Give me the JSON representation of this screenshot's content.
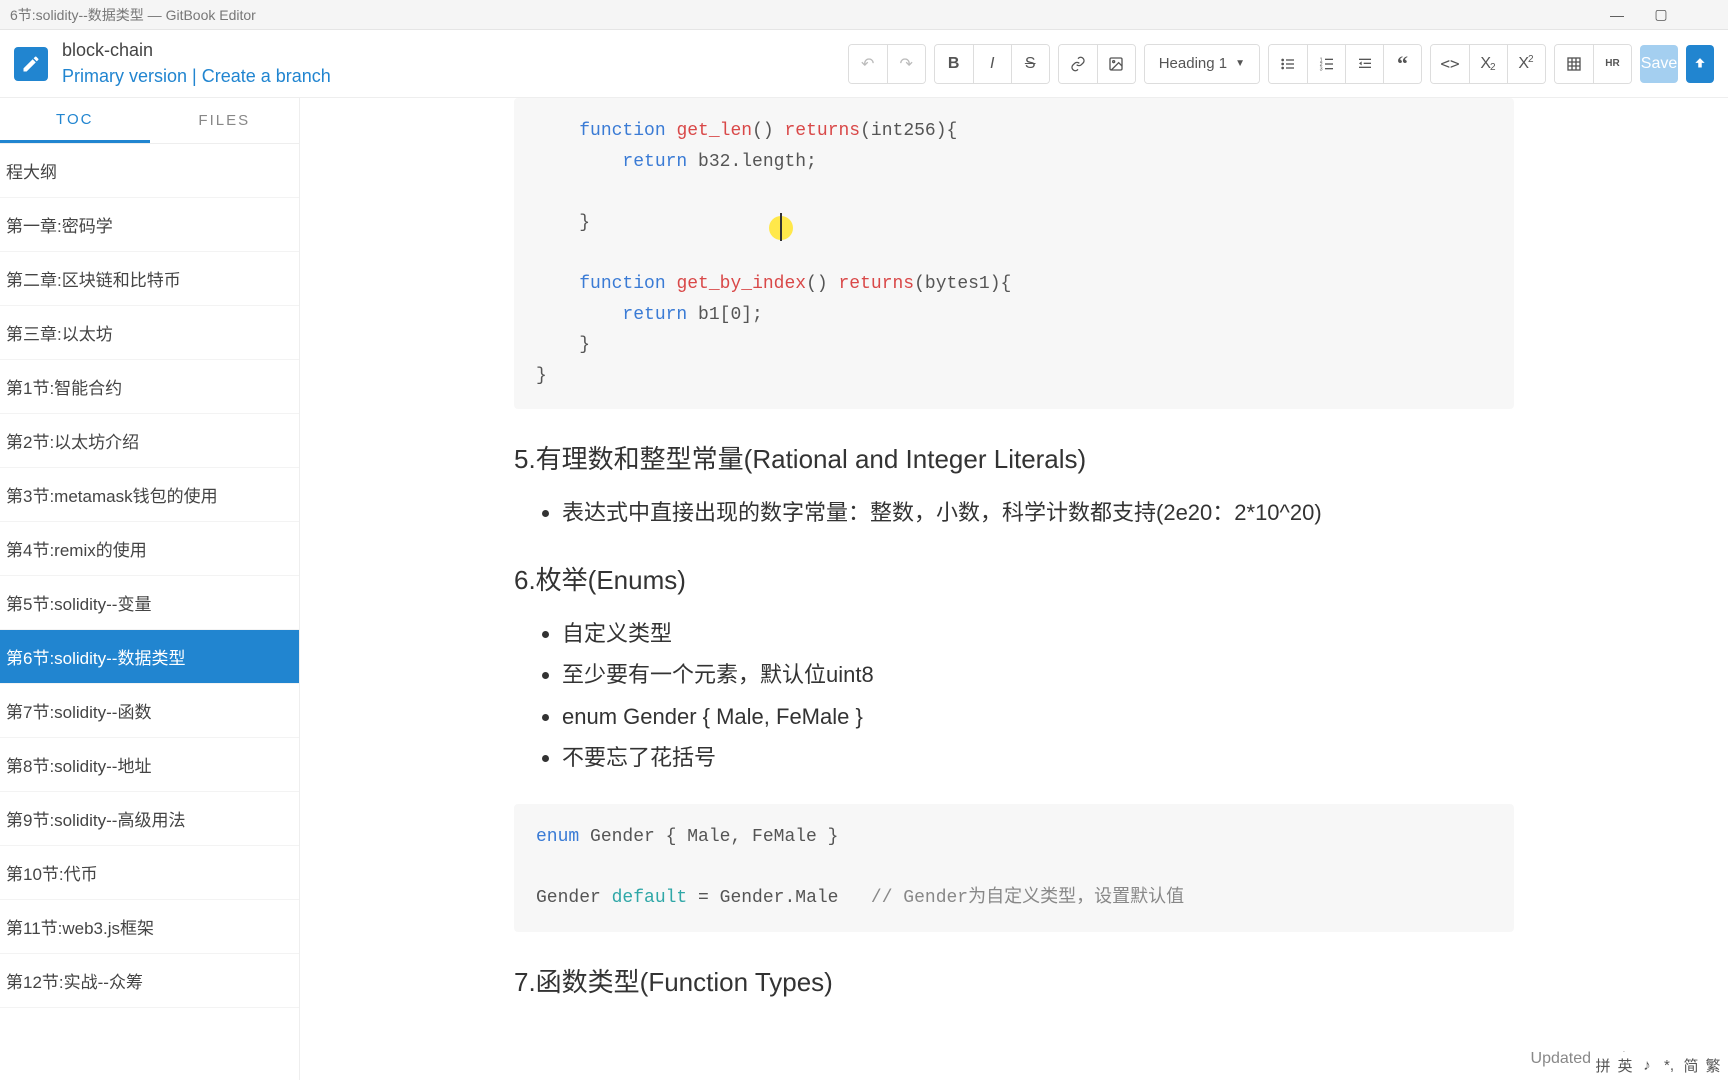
{
  "titlebar": {
    "title": "6节:solidity--数据类型 — GitBook Editor"
  },
  "header": {
    "bookname": "block-chain",
    "primary": "Primary version",
    "sep": "   |   ",
    "create_branch": "Create a branch",
    "heading_dd": "Heading 1",
    "save": "Save"
  },
  "tabs": {
    "toc": "TOC",
    "files": "FILES"
  },
  "toc": [
    "程大纲",
    "第一章:密码学",
    "第二章:区块链和比特币",
    "第三章:以太坊",
    "第1节:智能合约",
    "第2节:以太坊介绍",
    "第3节:metamask钱包的使用",
    "第4节:remix的使用",
    "第5节:solidity--变量",
    "第6节:solidity--数据类型",
    "第7节:solidity--函数",
    "第8节:solidity--地址",
    "第9节:solidity--高级用法",
    "第10节:代币",
    "第11节:web3.js框架",
    "第12节:实战--众筹"
  ],
  "toc_active_index": 9,
  "content": {
    "sec5_title": "5.有理数和整型常量(Rational and Integer Literals)",
    "sec5_item1": "表达式中直接出现的数字常量：整数，小数，科学计数都支持(2e20：2*10^20)",
    "sec6_title": "6.枚举(Enums)",
    "sec6_items": [
      "自定义类型",
      "至少要有一个元素，默认位uint8",
      "enum Gender { Male, FeMale }",
      "不要忘了花括号"
    ],
    "sec7_title": "7.函数类型(Function Types)"
  },
  "status": "Updated a minute ago",
  "ime": {
    "a": "拼",
    "b": "英",
    "c": "♪",
    "d": "*,",
    "e": "简",
    "f": "繁"
  },
  "code1": {
    "l1_kw1": "function",
    "l1_fn": "get_len",
    "l1_p": "() ",
    "l1_kw2": "returns",
    "l1_rest": "(int256){",
    "l2_kw": "return",
    "l2_rest": " b32.length;",
    "l3": "",
    "l4": "    }",
    "l5": "",
    "l6_kw1": "function",
    "l6_fn": "get_by_index",
    "l6_p": "() ",
    "l6_kw2": "returns",
    "l6_rest": "(bytes1){",
    "l7_kw": "return",
    "l7_rest": " b1[0];",
    "l8": "    }",
    "l9": "}"
  },
  "code2": {
    "l1_kw": "enum",
    "l1_rest": " Gender { Male, FeMale }",
    "l2_a": "Gender ",
    "l2_kw": "default",
    "l2_b": " = Gender.Male   ",
    "l2_c": "// Gender为自定义类型，设置默认值"
  }
}
